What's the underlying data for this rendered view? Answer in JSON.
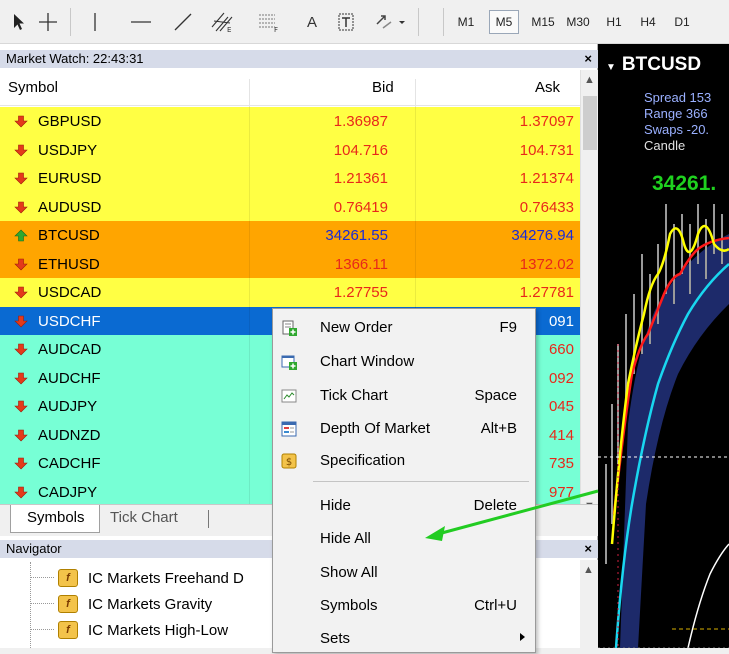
{
  "toolbar": {
    "text_tool_label": "A",
    "timeframes": [
      "M1",
      "M5",
      "M15",
      "M30",
      "H1",
      "H4",
      "D1"
    ],
    "active_timeframe": "M5"
  },
  "market_watch": {
    "title": "Market Watch: 22:43:31",
    "close_label": "×",
    "columns": {
      "symbol": "Symbol",
      "bid": "Bid",
      "ask": "Ask"
    },
    "rows": [
      {
        "symbol": "GBPUSD",
        "bid": "1.36987",
        "ask": "1.37097",
        "bg": "#ffff44",
        "price_color": "red",
        "dir": "down"
      },
      {
        "symbol": "USDJPY",
        "bid": "104.716",
        "ask": "104.731",
        "bg": "#ffff44",
        "price_color": "red",
        "dir": "down"
      },
      {
        "symbol": "EURUSD",
        "bid": "1.21361",
        "ask": "1.21374",
        "bg": "#ffff44",
        "price_color": "red",
        "dir": "down"
      },
      {
        "symbol": "AUDUSD",
        "bid": "0.76419",
        "ask": "0.76433",
        "bg": "#ffff44",
        "price_color": "red",
        "dir": "down"
      },
      {
        "symbol": "BTCUSD",
        "bid": "34261.55",
        "ask": "34276.94",
        "bg": "#ffa500",
        "price_color": "blue",
        "dir": "up"
      },
      {
        "symbol": "ETHUSD",
        "bid": "1366.11",
        "ask": "1372.02",
        "bg": "#ffa500",
        "price_color": "red",
        "dir": "down"
      },
      {
        "symbol": "USDCAD",
        "bid": "1.27755",
        "ask": "1.27781",
        "bg": "#ffff44",
        "price_color": "red",
        "dir": "down"
      },
      {
        "symbol": "USDCHF",
        "bid": "",
        "ask": "091",
        "bg": "#0a6ad2",
        "price_color": "white",
        "dir": "down",
        "selected": true
      },
      {
        "symbol": "AUDCAD",
        "bid": "",
        "ask": "660",
        "bg": "#77ffd5",
        "price_color": "red",
        "dir": "down"
      },
      {
        "symbol": "AUDCHF",
        "bid": "",
        "ask": "092",
        "bg": "#77ffd5",
        "price_color": "red",
        "dir": "down"
      },
      {
        "symbol": "AUDJPY",
        "bid": "",
        "ask": "045",
        "bg": "#77ffd5",
        "price_color": "red",
        "dir": "down"
      },
      {
        "symbol": "AUDNZD",
        "bid": "",
        "ask": "414",
        "bg": "#77ffd5",
        "price_color": "red",
        "dir": "down"
      },
      {
        "symbol": "CADCHF",
        "bid": "",
        "ask": "735",
        "bg": "#77ffd5",
        "price_color": "red",
        "dir": "down"
      },
      {
        "symbol": "CADJPY",
        "bid": "",
        "ask": "977",
        "bg": "#77ffd5",
        "price_color": "red",
        "dir": "down"
      }
    ],
    "tabs": {
      "symbols": "Symbols",
      "tick_chart": "Tick Chart"
    }
  },
  "navigator": {
    "title": "Navigator",
    "close_label": "×",
    "items": [
      {
        "label": "IC Markets Freehand D",
        "icon_letter": "f"
      },
      {
        "label": "IC Markets Gravity",
        "icon_letter": "f"
      },
      {
        "label": "IC Markets High-Low",
        "icon_letter": "f"
      }
    ]
  },
  "chart": {
    "symbol": "BTCUSD",
    "spread": "Spread 153",
    "range": "Range 366",
    "swaps": "Swaps -20.",
    "candle": "Candle",
    "price": "34261."
  },
  "context_menu": {
    "items": [
      {
        "label": "New Order",
        "shortcut": "F9",
        "icon": "new-order-icon"
      },
      {
        "label": "Chart Window",
        "shortcut": "",
        "icon": "chart-window-icon"
      },
      {
        "label": "Tick Chart",
        "shortcut": "Space",
        "icon": "tick-chart-icon"
      },
      {
        "label": "Depth Of Market",
        "shortcut": "Alt+B",
        "icon": "depth-of-market-icon"
      },
      {
        "label": "Specification",
        "shortcut": "",
        "icon": "specification-icon"
      },
      {
        "label": "Hide",
        "shortcut": "Delete"
      },
      {
        "label": "Hide All",
        "shortcut": ""
      },
      {
        "label": "Show All",
        "shortcut": ""
      },
      {
        "label": "Symbols",
        "shortcut": "Ctrl+U"
      },
      {
        "label": "Sets",
        "shortcut": "",
        "submenu": true
      }
    ]
  },
  "colors": {
    "annotation_arrow": "#22cc22",
    "selected_row": "#0a6ad2"
  }
}
